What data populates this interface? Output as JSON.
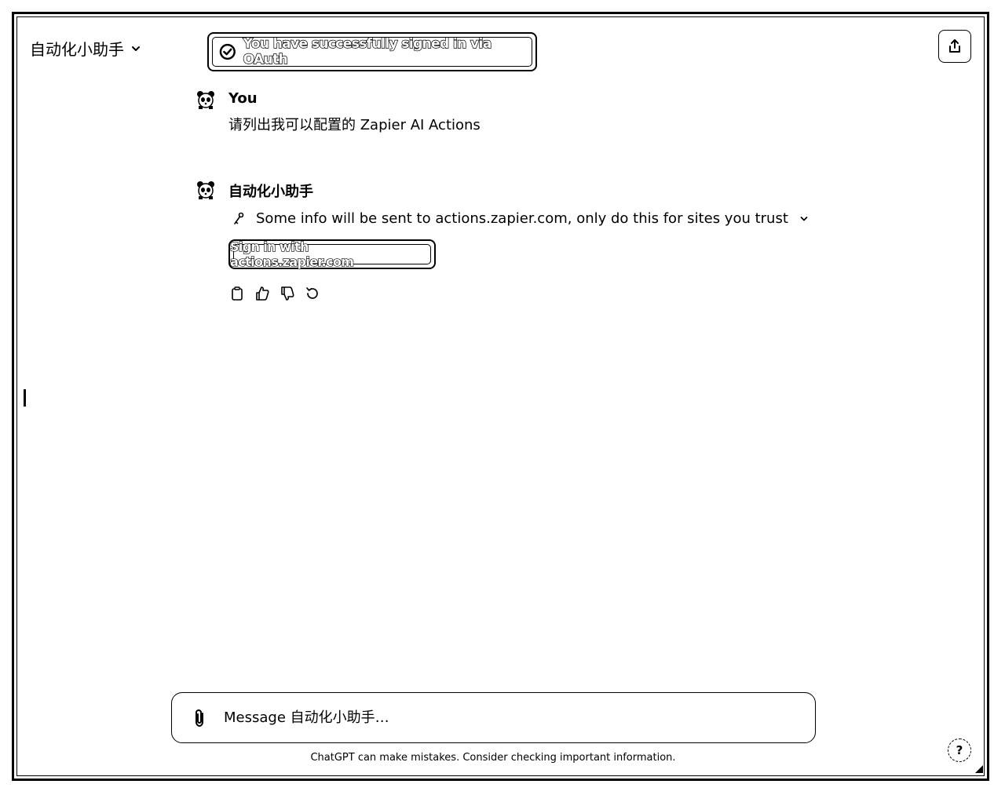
{
  "header": {
    "gpt_name": "自动化小助手"
  },
  "toast": {
    "text": "You have successfully signed in via OAuth"
  },
  "conversation": {
    "user": {
      "author": "You",
      "message": "请列出我可以配置的 Zapier AI Actions"
    },
    "assistant": {
      "author": "自动化小助手",
      "warning": "Some info will be sent to actions.zapier.com, only do this for sites you trust",
      "signin_label": "Sign in with actions.zapier.com"
    }
  },
  "composer": {
    "placeholder": "Message 自动化小助手…"
  },
  "footer": {
    "disclaimer": "ChatGPT can make mistakes. Consider checking important information.",
    "help_label": "?"
  },
  "icons": [
    "chevron-down-icon",
    "share-icon",
    "check-circle-icon",
    "panda-avatar-icon",
    "key-icon",
    "copy-icon",
    "thumbs-up-icon",
    "thumbs-down-icon",
    "regenerate-icon",
    "paperclip-icon"
  ]
}
